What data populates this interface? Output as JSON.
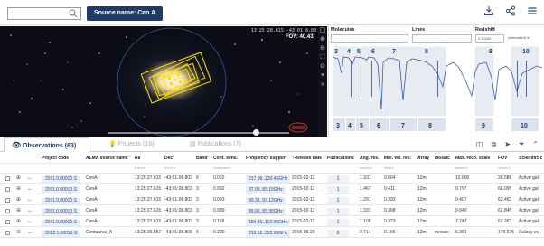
{
  "header": {
    "search": {
      "placeholder": ""
    },
    "source_chip": "Source name: Cen A",
    "icons": [
      "download-icon",
      "share-icon",
      "menu-icon"
    ]
  },
  "sky": {
    "coords": "13 25 28.615 -43 01 8.83",
    "fov": "FOV: 40.43'",
    "tools": [
      "square-icon",
      "zoom-in-icon",
      "zoom-out-icon",
      "fullscreen-icon",
      "target-icon",
      "layers-icon",
      "expand-icon"
    ]
  },
  "spectral": {
    "molecules_label": "Molecules",
    "lines_label": "Lines",
    "redshift_label": "Redshift",
    "molecules_value": "-",
    "lines_value": "-",
    "redshift_value": "0.00183",
    "redshift_unit": "(estimated) ▾",
    "band_labels_top": [
      "3",
      "4",
      "5",
      "6",
      "7",
      "8",
      "9",
      "10"
    ],
    "band_labels_bottom": [
      "3",
      "4",
      "5",
      "6",
      "7",
      "8",
      "9",
      "10"
    ]
  },
  "tabs": {
    "observations": "Observations (63)",
    "projects": "Projects (18)",
    "publications": "Publications (7)"
  },
  "table": {
    "headers": [
      "Project code",
      "ALMA source name",
      "Ra",
      "Dec",
      "Band",
      "Cont. sens.",
      "Frequency support",
      "↑Release date",
      "Publications",
      "Ang. res.",
      "Min. vel. res.",
      "Array",
      "Mosaic",
      "Max. reco. scale",
      "FOV",
      "Scientific c"
    ],
    "filters": [
      "",
      "",
      "h:m:s ▾",
      "d:m:s ▾",
      "",
      "mJy/beam ▾",
      "",
      "",
      "",
      "arcsec ▾",
      "km/s ▾",
      "",
      "",
      "arcsec ▾",
      "arcsec ▾",
      ""
    ],
    "rows": [
      [
        "2011.0.00010.S",
        "CenA",
        "13:25:27.615",
        "-43:01:08.803",
        "6",
        "0.062",
        "217.99..220.46GHz",
        "2015-02-12",
        "1",
        "1.331",
        "0.664",
        "12m",
        "",
        "12.600",
        "26.586",
        "Active gal"
      ],
      [
        "2011.0.00010.S",
        "CenA",
        "13:25:27.615",
        "-43:01:08.803",
        "3",
        "0.092",
        "87.05..89.15GHz",
        "2015-02-12",
        "1",
        "1.467",
        "0.411",
        "12m",
        "",
        "9.797",
        "66.095",
        "Active gal"
      ],
      [
        "2011.0.00010.S",
        "CenA",
        "13:25:27.615",
        "-43:01:08.803",
        "3",
        "0.093",
        "90.36..93.12GHz",
        "2015-02-12",
        "1",
        "1.291",
        "0.393",
        "12m",
        "",
        "9.407",
        "63.463",
        "Active gal"
      ],
      [
        "2011.0.00010.S",
        "CenA",
        "13:25:27.615",
        "-43:01:08.803",
        "3",
        "0.089",
        "85.96..89.35GHz",
        "2015-02-12",
        "1",
        "1.331",
        "0.368",
        "12m",
        "",
        "9.840",
        "62.845",
        "Active gal"
      ],
      [
        "2011.0.00010.S",
        "CenA",
        "13:25:27.615",
        "-43:01:08.803",
        "3",
        "0.118",
        "109.45..113.36GHz",
        "2015-02-12",
        "1",
        "1.106",
        "0.323",
        "12m",
        "",
        "7.747",
        "52.263",
        "Active gal"
      ],
      [
        "2012.1.00019.S",
        "Centaurus_A",
        "13:25:26.557",
        "-43:01:28.806",
        "6",
        "0.220",
        "218.16..222.99GHz",
        "2015-05-23",
        "0",
        "0.714",
        "0.166",
        "12m",
        "mosaic",
        "6.361",
        "176.675",
        "Galaxy ev"
      ]
    ]
  }
}
